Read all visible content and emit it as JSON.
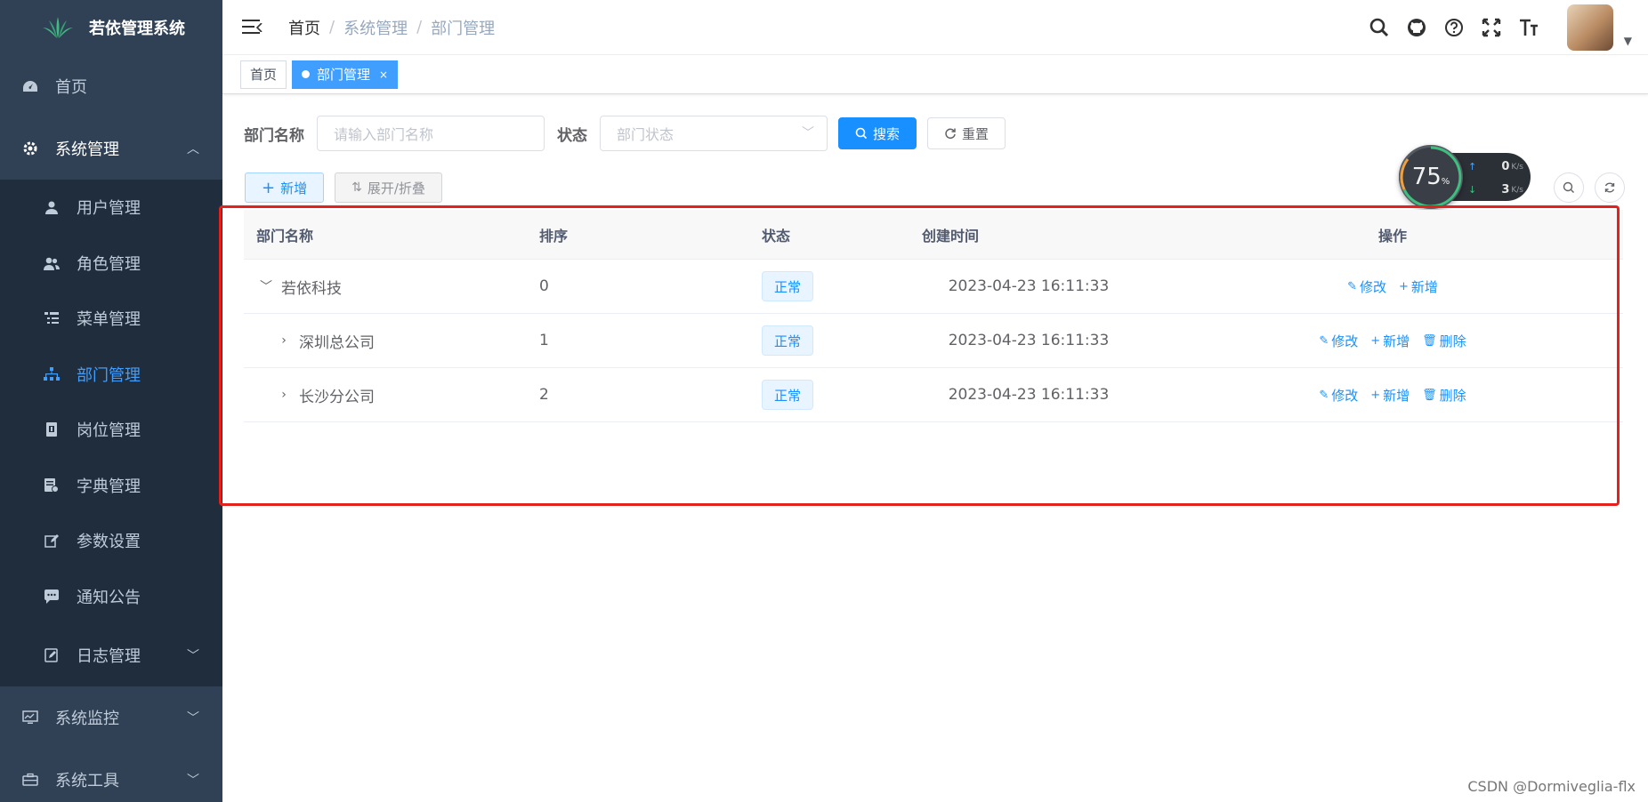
{
  "sidebar": {
    "logo_title": "若依管理系统",
    "items": [
      {
        "label": "首页",
        "icon": "dashboard-icon"
      },
      {
        "label": "系统管理",
        "icon": "gear-icon",
        "expanded": true
      },
      {
        "label": "系统监控",
        "icon": "monitor-icon"
      },
      {
        "label": "系统工具",
        "icon": "toolbox-icon"
      }
    ],
    "submenu": [
      {
        "label": "用户管理",
        "icon": "user-icon"
      },
      {
        "label": "角色管理",
        "icon": "peoples-icon"
      },
      {
        "label": "菜单管理",
        "icon": "tree-table-icon"
      },
      {
        "label": "部门管理",
        "icon": "tree-icon",
        "active": true
      },
      {
        "label": "岗位管理",
        "icon": "post-icon"
      },
      {
        "label": "字典管理",
        "icon": "dict-icon"
      },
      {
        "label": "参数设置",
        "icon": "edit-icon"
      },
      {
        "label": "通知公告",
        "icon": "message-icon"
      },
      {
        "label": "日志管理",
        "icon": "log-icon"
      }
    ]
  },
  "breadcrumb": {
    "home": "首页",
    "level1": "系统管理",
    "level2": "部门管理"
  },
  "tags": [
    {
      "label": "首页",
      "active": false
    },
    {
      "label": "部门管理",
      "active": true,
      "close": "×"
    }
  ],
  "search": {
    "name_label": "部门名称",
    "name_placeholder": "请输入部门名称",
    "status_label": "状态",
    "status_placeholder": "部门状态",
    "search_button": "搜索",
    "reset_button": "重置"
  },
  "toolbar": {
    "add_button": "新增",
    "toggle_button": "展开/折叠"
  },
  "net_widget": {
    "percent": "75",
    "percent_unit": "%",
    "up_value": "0",
    "down_value": "3",
    "unit": "K/s"
  },
  "table": {
    "headers": {
      "name": "部门名称",
      "order": "排序",
      "status": "状态",
      "created": "创建时间",
      "ops": "操作"
    },
    "rows": [
      {
        "name": "若依科技",
        "order": "0",
        "status": "正常",
        "created": "2023-04-23 16:11:33",
        "edit": "修改",
        "add": "新增"
      },
      {
        "name": "深圳总公司",
        "order": "1",
        "status": "正常",
        "created": "2023-04-23 16:11:33",
        "edit": "修改",
        "add": "新增",
        "delete": "删除"
      },
      {
        "name": "长沙分公司",
        "order": "2",
        "status": "正常",
        "created": "2023-04-23 16:11:33",
        "edit": "修改",
        "add": "新增",
        "delete": "删除"
      }
    ]
  },
  "watermark": "CSDN @Dormiveglia-flx",
  "colors": {
    "sidebar_bg": "#304156",
    "submenu_bg": "#1f2d3d",
    "primary": "#1890ff",
    "highlight": "#e5211d"
  }
}
